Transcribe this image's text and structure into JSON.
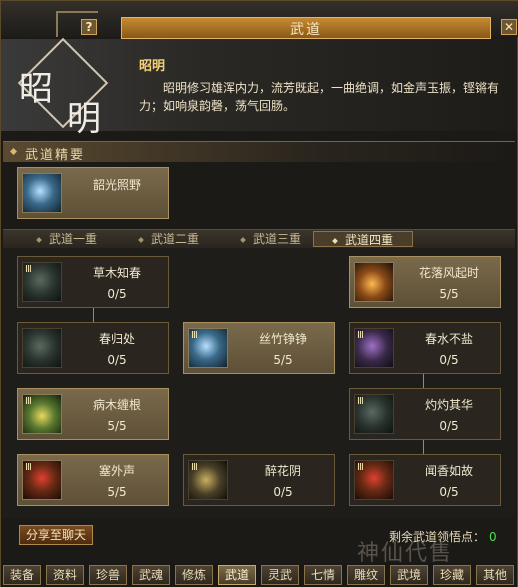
{
  "window": {
    "title": "武道",
    "help_label": "?",
    "close_label": "✕"
  },
  "header": {
    "emblem_char1": "昭",
    "emblem_char2": "明",
    "name": "昭明",
    "description": "昭明修习雄浑内力，流芳既起，一曲绝调，如金声玉振，铿锵有力；如响泉韵磬，荡气回肠。"
  },
  "essence": {
    "label": "武道精要",
    "skill": {
      "name": "韶光照野",
      "icon": "light-burst-icon"
    }
  },
  "tiers": {
    "items": [
      "武道一重",
      "武道二重",
      "武道三重",
      "武道四重"
    ],
    "active_index": 3
  },
  "tree": {
    "skills": [
      {
        "name": "草木知春",
        "level": "0/5",
        "rank": "Ⅲ",
        "icon": "grass-spring-icon"
      },
      {
        "name": "花落风起时",
        "level": "5/5",
        "rank": "",
        "icon": "falling-flower-icon"
      },
      {
        "name": "春归处",
        "level": "0/5",
        "rank": "",
        "icon": "spring-return-icon"
      },
      {
        "name": "丝竹铮铮",
        "level": "5/5",
        "rank": "Ⅲ",
        "icon": "string-music-icon"
      },
      {
        "name": "春水不盐",
        "level": "0/5",
        "rank": "Ⅲ",
        "icon": "spring-water-icon"
      },
      {
        "name": "病木缠根",
        "level": "5/5",
        "rank": "Ⅲ",
        "icon": "withered-wood-icon"
      },
      {
        "name": "灼灼其华",
        "level": "0/5",
        "rank": "Ⅲ",
        "icon": "blazing-bloom-icon"
      },
      {
        "name": "塞外声",
        "level": "5/5",
        "rank": "Ⅲ",
        "icon": "frontier-sound-icon"
      },
      {
        "name": "醉花阴",
        "level": "0/5",
        "rank": "Ⅲ",
        "icon": "drunk-flower-icon"
      },
      {
        "name": "闻香如故",
        "level": "0/5",
        "rank": "Ⅲ",
        "icon": "fragrance-icon"
      }
    ]
  },
  "footer": {
    "share_label": "分享至聊天",
    "remaining_label": "剩余武道领悟点：",
    "remaining_value": "0"
  },
  "bottom_tabs": {
    "items": [
      "装备",
      "资料",
      "珍兽",
      "武魂",
      "修炼",
      "武道",
      "灵武",
      "七情",
      "雕纹",
      "武境",
      "珍藏",
      "其他"
    ],
    "active_index": 5
  },
  "watermark": "神仙代售",
  "colors": {
    "accent": "#c58a32",
    "highlight": "#f3d07a",
    "points": "#48e048"
  }
}
